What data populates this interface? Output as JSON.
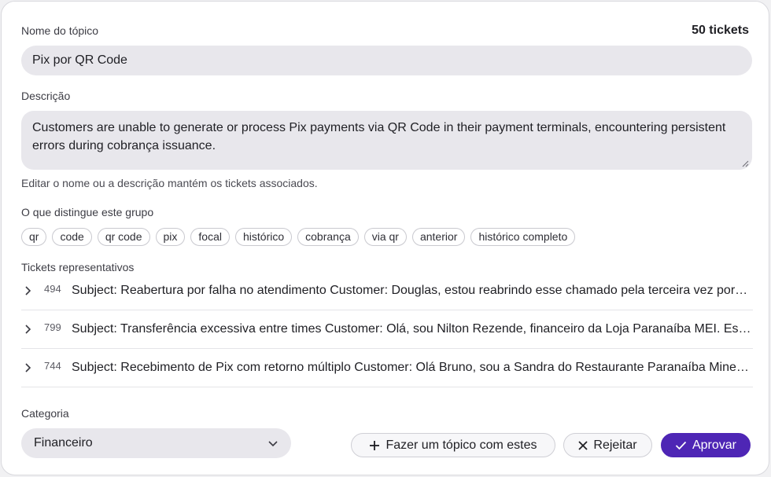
{
  "form": {
    "name_label": "Nome do tópico",
    "ticket_count": "50 tickets",
    "name_value": "Pix por QR Code",
    "description_label": "Descrição",
    "description_value": "Customers are unable to generate or process Pix payments via QR Code in their payment terminals, encountering persistent errors during cobrança issuance.",
    "hint": "Editar o nome ou a descrição mantém os tickets associados."
  },
  "keywords": {
    "label": "O que distingue este grupo",
    "items": [
      "qr",
      "code",
      "qr code",
      "pix",
      "focal",
      "histórico",
      "cobrança",
      "via qr",
      "anterior",
      "histórico completo"
    ]
  },
  "tickets": {
    "label": "Tickets representativos",
    "items": [
      {
        "id": "494",
        "subject": "Subject: Reabertura por falha no atendimento Customer: Douglas, estou reabrindo esse chamado pela terceira vez porque o problema continua"
      },
      {
        "id": "799",
        "subject": "Subject: Transferência excessiva entre times Customer: Olá, sou Nilton Rezende, financeiro da Loja Paranaíba MEI. Estou com problemas"
      },
      {
        "id": "744",
        "subject": "Subject: Recebimento de Pix com retorno múltiplo Customer: Olá Bruno, sou a Sandra do Restaurante Paranaíba Mineira e preciso de ajuda"
      }
    ]
  },
  "category": {
    "label": "Categoria",
    "selected": "Financeiro"
  },
  "actions": {
    "create_topic": "Fazer um tópico com estes",
    "reject": "Rejeitar",
    "approve": "Aprovar"
  },
  "icons": {
    "plus": "plus-icon",
    "close": "close-icon",
    "check": "check-icon",
    "chevron_down": "chevron-down-icon",
    "chevron_right": "chevron-right-icon"
  },
  "colors": {
    "primary": "#4e26b5",
    "input_bg": "#e8e7ec"
  }
}
